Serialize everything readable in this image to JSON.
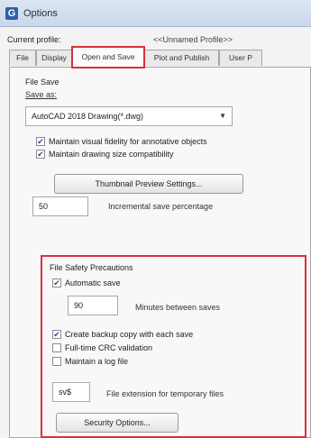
{
  "window": {
    "title": "Options",
    "icon_letter": "G"
  },
  "profile": {
    "label": "Current profile:",
    "value": "<<Unnamed Profile>>"
  },
  "tabs": [
    {
      "label": "File"
    },
    {
      "label": "Display"
    },
    {
      "label": "Open and Save"
    },
    {
      "label": "Plot and Publish"
    },
    {
      "label": "User P"
    }
  ],
  "active_tab": "Open and Save",
  "file_save": {
    "title": "File Save",
    "save_as_label": "Save as:",
    "save_as_value": "AutoCAD 2018 Drawing(*.dwg)",
    "maintain_visual_fidelity": {
      "label": "Maintain visual fidelity for annotative objects",
      "checked": true
    },
    "maintain_drawing_size": {
      "label": "Maintain drawing size compatibility",
      "checked": true
    },
    "thumbnail_button": "Thumbnail Preview Settings...",
    "incremental_value": "50",
    "incremental_label": "Incremental save percentage"
  },
  "file_safety": {
    "title": "File Safety Precautions",
    "automatic_save": {
      "label": "Automatic save",
      "checked": true
    },
    "minutes_value": "90",
    "minutes_label": "Minutes between saves",
    "backup_copy": {
      "label": "Create backup copy with each save",
      "checked": true
    },
    "crc_validation": {
      "label": "Full-time CRC validation",
      "checked": false
    },
    "log_file": {
      "label": "Maintain a log file",
      "checked": false
    },
    "temp_ext_value": "sv$",
    "temp_ext_label": "File extension for temporary files",
    "security_button": "Security Options..."
  },
  "colors": {
    "highlight": "#d8303b",
    "accent": "#2f5fa8"
  }
}
